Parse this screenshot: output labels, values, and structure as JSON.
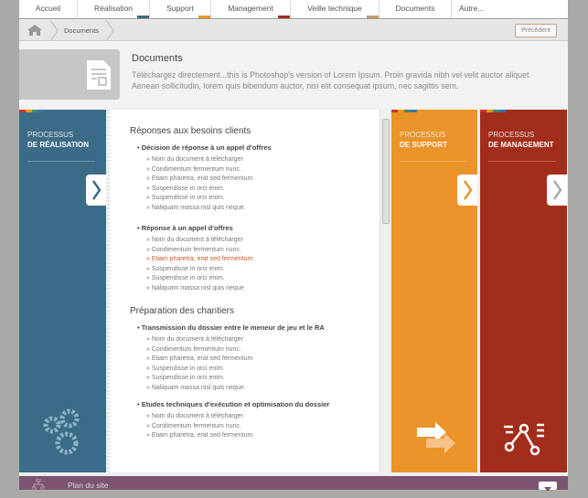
{
  "nav": [
    {
      "label": "Accueil"
    },
    {
      "label": "Réalisation"
    },
    {
      "label": "Support"
    },
    {
      "label": "Management"
    },
    {
      "label": "Veille technique"
    },
    {
      "label": "Documents"
    },
    {
      "label": "Autre..."
    }
  ],
  "breadcrumb": {
    "current": "Documents",
    "prev_label": "Précédent"
  },
  "header": {
    "title": "Documents",
    "text": "Téléchargez directement...this is Photoshop's version of Lorem Ipsum. Proin gravida nibh vel velit auctor aliquet. Aenean sollicitudin, lorem quis bibendum auctor, nisi elit consequat ipsum, nec sagittis sem."
  },
  "panels": {
    "realisation": {
      "l1": "PROCESSUS",
      "l2": "DE RÉALISATION",
      "color": "#3b6c87"
    },
    "support": {
      "l1": "PROCESSUS",
      "l2": "DE SUPPORT",
      "color": "#ea9328"
    },
    "management": {
      "l1": "PROCESSUS",
      "l2": "DE MANAGEMENT",
      "color": "#a32d1b"
    }
  },
  "content": {
    "s1": {
      "title": "Réponses aux besoins clients",
      "g1": {
        "title": "Décision de réponse à un appel d'offres",
        "items": [
          "Nom du document à télécharger",
          "Condimentum fermentum nunc.",
          "Etiam pharetra, erat sed fermentum",
          "Suspendisse in orci enim.",
          "Suspendisse in orci enim.",
          "Naliquam massa nisl quis neque."
        ]
      },
      "g2": {
        "title": "Réponse à un appel d'offres",
        "items": [
          "Nom du document à télécharger",
          "Condimentum fermentum nunc.",
          "Etiam pharetra, erat sed fermentum",
          "Suspendisse in orci enim.",
          "Suspendisse in orci enim.",
          "Naliquam massa nisl quis neque."
        ]
      }
    },
    "s2": {
      "title": "Préparation des chantiers",
      "g1": {
        "title": "Transmission du dossier entre le meneur de jeu et le RA",
        "items": [
          "Nom du document à télécharger",
          "Condimentum fermentum nunc.",
          "Etiam pharetra, erat sed fermentum",
          "Suspendisse in orci enim.",
          "Suspendisse in orci enim.",
          "Naliquam massa nisl quis neque."
        ]
      },
      "g2": {
        "title": "Etudes techniques d'exécution et optimisation du dossier",
        "items": [
          "Nom du document à télécharger",
          "Condimentum fermentum nunc.",
          "Etiam pharetra, erat sed fermentum"
        ]
      }
    }
  },
  "footer": {
    "label": "Plan du site"
  }
}
